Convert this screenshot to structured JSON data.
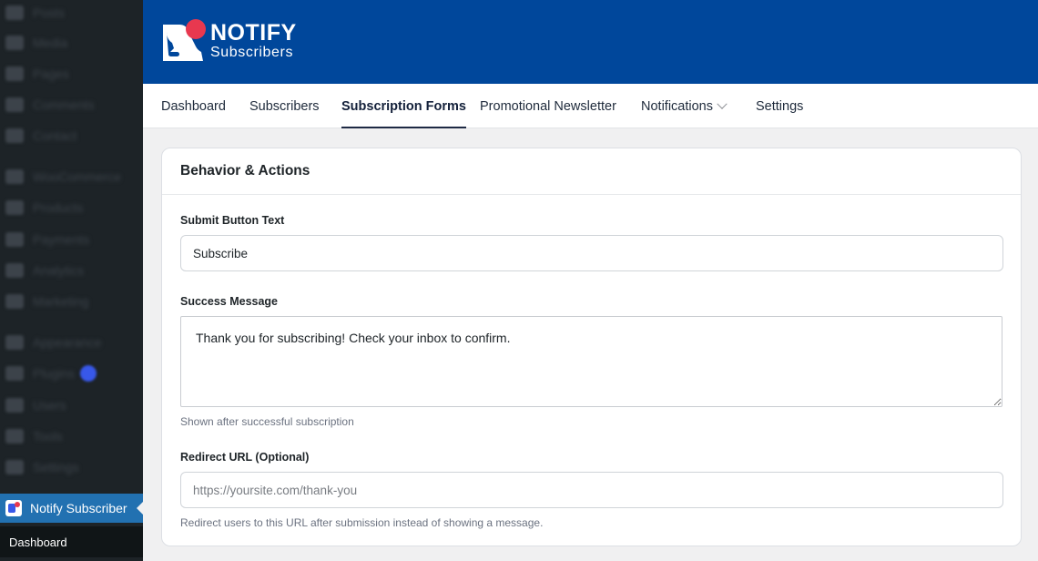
{
  "wp_sidebar": {
    "blurred_items": [
      {
        "label": "Posts",
        "icon": "pin-icon"
      },
      {
        "label": "Media",
        "icon": "media-icon"
      },
      {
        "label": "Pages",
        "icon": "page-icon"
      },
      {
        "label": "Comments",
        "icon": "comment-icon"
      },
      {
        "label": "Contact",
        "icon": "mail-icon"
      },
      {
        "label": "WooCommerce",
        "icon": "woo-icon"
      },
      {
        "label": "Products",
        "icon": "archive-icon"
      },
      {
        "label": "Payments",
        "icon": "card-icon"
      },
      {
        "label": "Analytics",
        "icon": "chart-icon"
      },
      {
        "label": "Marketing",
        "icon": "megaphone-icon"
      },
      {
        "label": "Appearance",
        "icon": "brush-icon"
      },
      {
        "label": "Plugins",
        "icon": "plugin-icon"
      },
      {
        "label": "Users",
        "icon": "user-icon"
      },
      {
        "label": "Tools",
        "icon": "wrench-icon"
      },
      {
        "label": "Settings",
        "icon": "settings-icon"
      }
    ],
    "active_item": "Notify Subscriber",
    "submenu_item": "Dashboard"
  },
  "brand": {
    "line1": "NOTIFY",
    "line2": "Subscribers",
    "header_color": "#00479b",
    "accent_red": "#e8384f"
  },
  "nav": {
    "items": [
      "Dashboard",
      "Subscribers",
      "Subscription Forms",
      "Promotional Newsletter",
      "Notifications",
      "Settings"
    ],
    "active": "Subscription Forms"
  },
  "card": {
    "title": "Behavior & Actions",
    "submit_button_text": {
      "label": "Submit Button Text",
      "value": "Subscribe"
    },
    "success_message": {
      "label": "Success Message",
      "value": "Thank you for subscribing! Check your inbox to confirm.",
      "help": "Shown after successful subscription"
    },
    "redirect_url": {
      "label": "Redirect URL (Optional)",
      "value": "",
      "placeholder": "https://yoursite.com/thank-you",
      "help": "Redirect users to this URL after submission instead of showing a message."
    }
  }
}
